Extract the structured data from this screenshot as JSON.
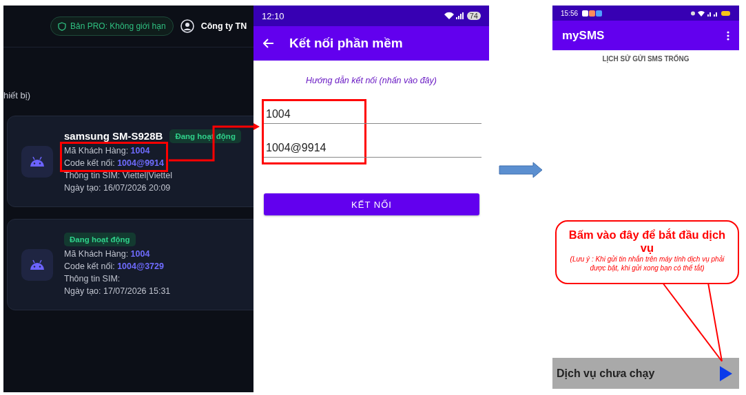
{
  "web_panel": {
    "pro_badge": "Bản PRO: Không giới hạn",
    "company": "Công ty TN",
    "section_caption": "hiết bị)",
    "devices": [
      {
        "name": "samsung SM-S928B",
        "status": "Đang hoạt động",
        "customer": "Mã Khách Hàng: **1004**",
        "code": "Code kết nối: **1004@9914**",
        "sim": "Thông tin SIM: Viettel|Viettel",
        "created": "Ngày tạo: 16/07/2026 20:09",
        "highlighted": true
      },
      {
        "status": "Đang hoạt động",
        "customer": "Mã Khách Hàng: **1004**",
        "code": "Code kết nối: **1004@3729**",
        "sim": "Thông tin SIM:",
        "created": "Ngày tạo: 17/07/2026 15:31",
        "highlighted": false
      }
    ]
  },
  "connect_screen": {
    "time": "12:10",
    "battery": "74",
    "title": "Kết nối phần mềm",
    "guide_link": "Hướng dẫn kết nối (nhấn vào đây)",
    "fields": [
      {
        "value": "1004"
      },
      {
        "value": "1004@9914"
      }
    ],
    "fields_highlighted": true,
    "button": "KẾT NỐI"
  },
  "sms_screen": {
    "time": "15:56",
    "title": "mySMS",
    "empty_message": "LỊCH SỬ GỬI SMS TRỐNG",
    "service_status": "Dịch vụ chưa chạy",
    "callout": {
      "heading": "Bấm vào đây để bắt đầu dịch vụ",
      "note": "(Lưu ý : Khi gửi tin nhắn trên máy tính dịch vụ phải được bật, khi gửi xong bạn có thể tắt)"
    }
  }
}
